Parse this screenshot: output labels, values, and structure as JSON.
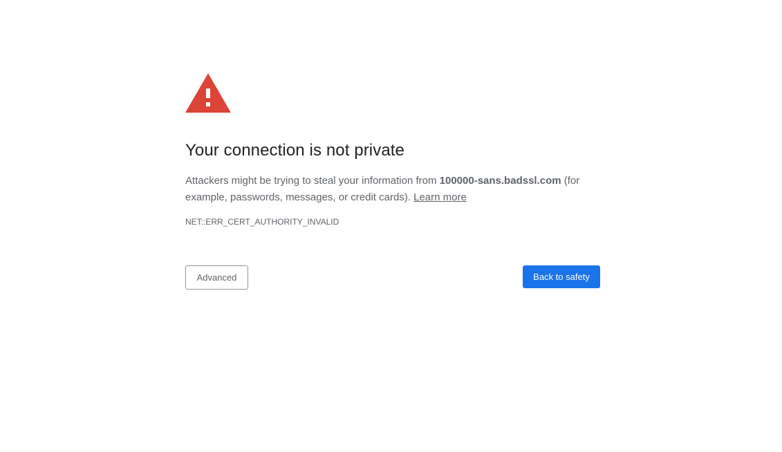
{
  "interstitial": {
    "icon": "warning-triangle-icon",
    "icon_color": "#db4437",
    "title": "Your connection is not private",
    "body_prefix": "Attackers might be trying to steal your information from ",
    "host": "100000-sans.badssl.com",
    "body_suffix": " (for example, passwords, messages, or credit cards). ",
    "learn_more": "Learn more",
    "error_code": "NET::ERR_CERT_AUTHORITY_INVALID",
    "advanced_label": "Advanced",
    "back_label": "Back to safety",
    "primary_color": "#1a73e8"
  }
}
